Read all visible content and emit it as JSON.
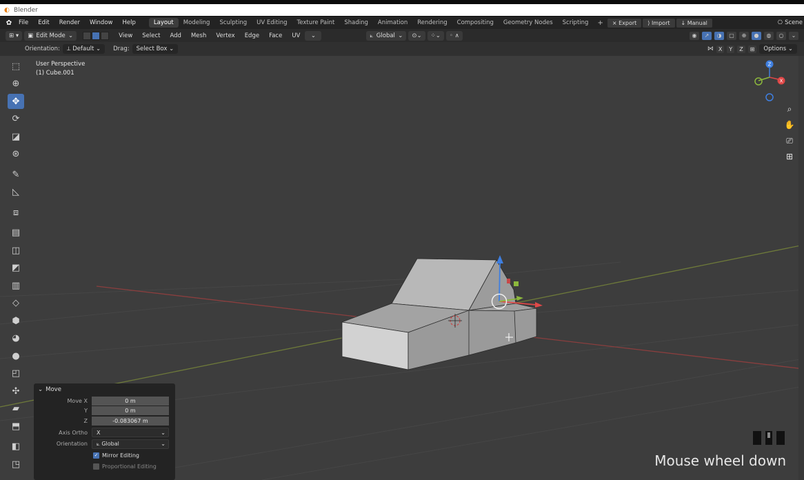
{
  "window": {
    "title": "Blender"
  },
  "menus": [
    "File",
    "Edit",
    "Render",
    "Window",
    "Help"
  ],
  "workspaces": [
    {
      "label": "Layout",
      "active": true
    },
    {
      "label": "Modeling"
    },
    {
      "label": "Sculpting"
    },
    {
      "label": "UV Editing"
    },
    {
      "label": "Texture Paint"
    },
    {
      "label": "Shading"
    },
    {
      "label": "Animation"
    },
    {
      "label": "Rendering"
    },
    {
      "label": "Compositing"
    },
    {
      "label": "Geometry Nodes"
    },
    {
      "label": "Scripting"
    }
  ],
  "topbar_buttons": {
    "export": "Export",
    "import": "Import",
    "manual": "Manual",
    "scene": "Scene"
  },
  "header": {
    "mode": "Edit Mode",
    "menus": [
      "View",
      "Select",
      "Add",
      "Mesh",
      "Vertex",
      "Edge",
      "Face",
      "UV"
    ],
    "transform_orientation": "Global"
  },
  "subheader": {
    "orientation_label": "Orientation:",
    "orientation_value": "Default",
    "drag_label": "Drag:",
    "drag_value": "Select Box",
    "axes": [
      "X",
      "Y",
      "Z"
    ],
    "options": "Options"
  },
  "viewport": {
    "perspective": "User Perspective",
    "object": "(1) Cube.001"
  },
  "gizmo": {
    "z": "Z",
    "x": "X"
  },
  "operator_panel": {
    "title": "Move",
    "move_x_label": "Move X",
    "move_x": "0 m",
    "y_label": "Y",
    "move_y": "0 m",
    "z_label": "Z",
    "move_z": "-0.083067 m",
    "axis_ortho_label": "Axis Ortho",
    "axis_ortho": "X",
    "orientation_label": "Orientation",
    "orientation": "Global",
    "mirror_editing": "Mirror Editing",
    "mirror_checked": true,
    "proportional_editing": "Proportional Editing",
    "proportional_checked": false
  },
  "keycast": "Mouse wheel down",
  "colors": {
    "accent": "#4772b3",
    "viewport": "#3d3d3d",
    "x_axis": "#e04848",
    "y_axis": "#8cb83c",
    "z_axis": "#3f7fe0"
  }
}
